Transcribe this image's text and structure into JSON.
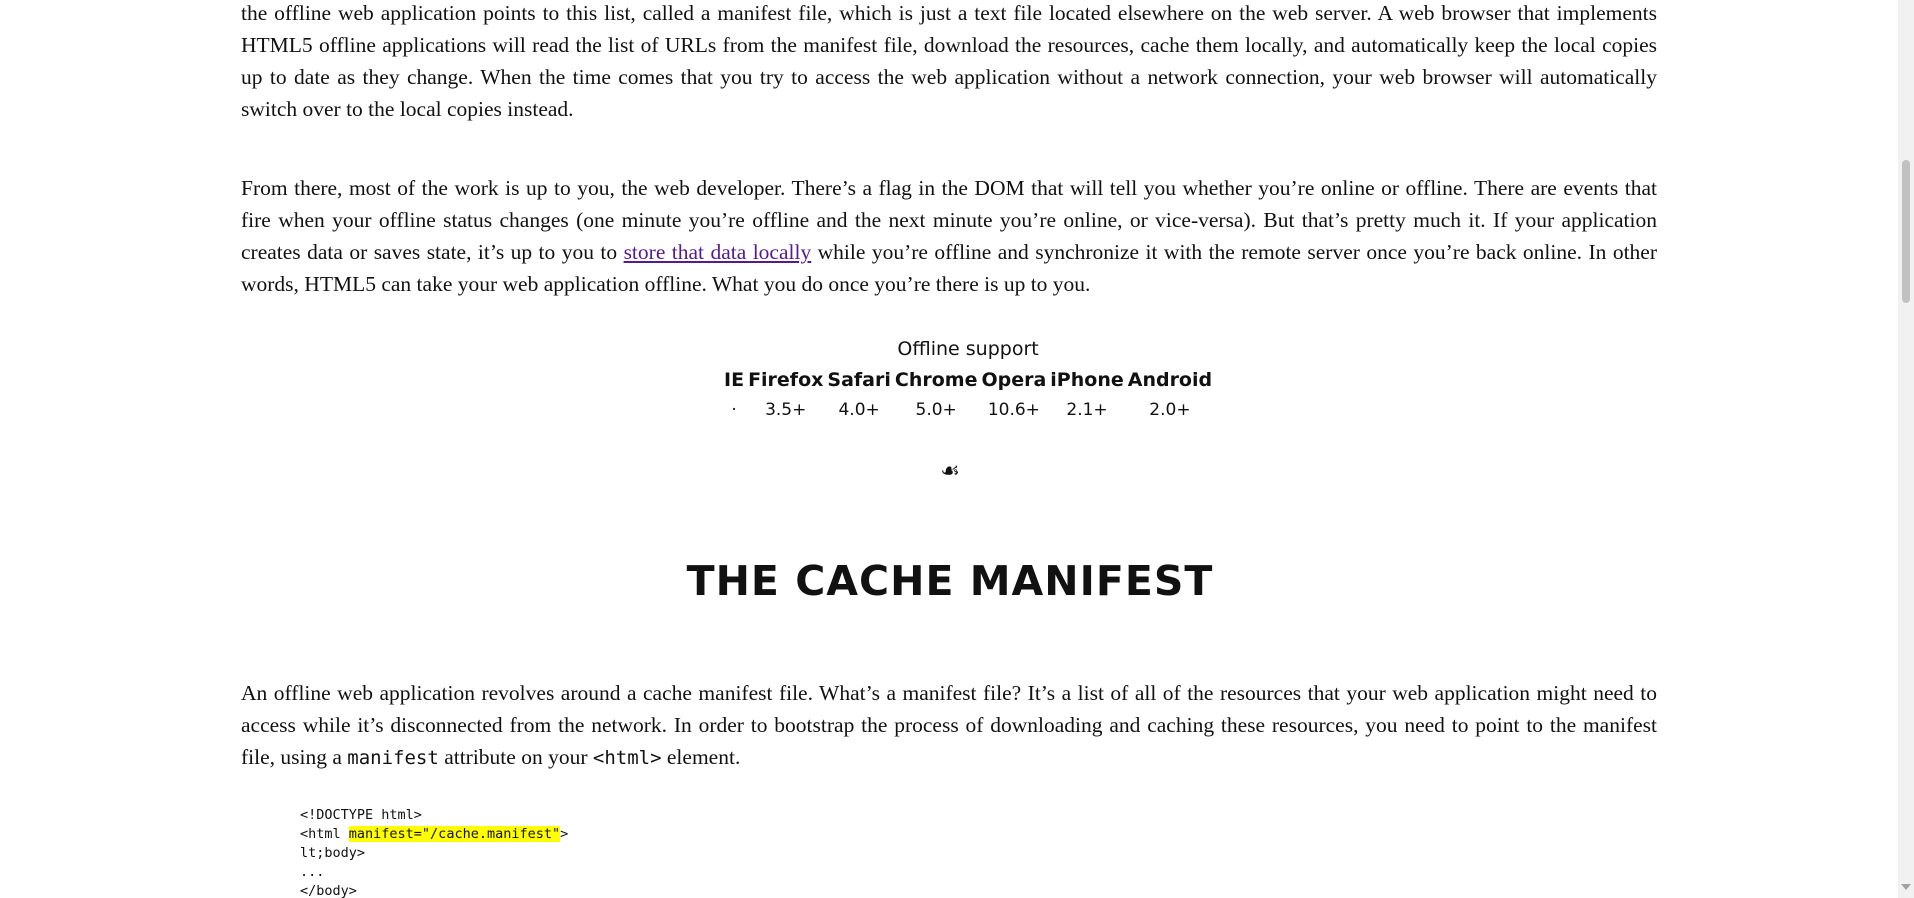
{
  "article": {
    "para1": "the offline web application points to this list, called a manifest file, which is just a text file located elsewhere on the web server. A web browser that implements HTML5 offline applications will read the list of URLs from the manifest file, download the resources, cache them locally, and automatically keep the local copies up to date as they change. When the time comes that you try to access the web application without a network connection, your web browser will automatically switch over to the local copies instead.",
    "para2_before": "From there, most of the work is up to you, the web developer. There’s a flag in the DOM that will tell you whether you’re online or offline. There are events that fire when your offline status changes (one minute you’re offline and the next minute you’re online, or vice-versa). But that’s pretty much it. If your application creates data or saves state, it’s up to you to ",
    "para2_link": "store that data locally",
    "para2_after": " while you’re offline and synchronize it with the remote server once you’re back online. In other words, HTML5 can take your web application offline. What you do once you’re there is up to you.",
    "para3_before": "An offline web application revolves around a cache manifest file. What’s a manifest file? It’s a list of all of the resources that your web application might need to access while it’s disconnected from the network. In order to bootstrap the process of downloading and caching these resources, you need to point to the manifest file, using a ",
    "para3_code1": "manifest",
    "para3_mid": " attribute on your ",
    "para3_code2": "<html>",
    "para3_after": " element."
  },
  "support_table": {
    "caption": "Offline support",
    "headers": [
      "IE",
      "Firefox",
      "Safari",
      "Chrome",
      "Opera",
      "iPhone",
      "Android"
    ],
    "values": [
      "·",
      "3.5+",
      "4.0+",
      "5.0+",
      "10.6+",
      "2.1+",
      "2.0+"
    ]
  },
  "fleuron": "☙",
  "section_heading": "THE CACHE MANIFEST",
  "code_sample": {
    "line1": "<!DOCTYPE html>",
    "line2_prefix": "<html ",
    "line2_highlight": "manifest=\"/cache.manifest\"",
    "line2_suffix": ">",
    "line3": "lt;body>",
    "line4": "...",
    "line5": "</body>"
  },
  "colors": {
    "link_visited": "#551a8b",
    "code_highlight": "#ffff00",
    "scrollbar_thumb": "#c1c1c1"
  }
}
